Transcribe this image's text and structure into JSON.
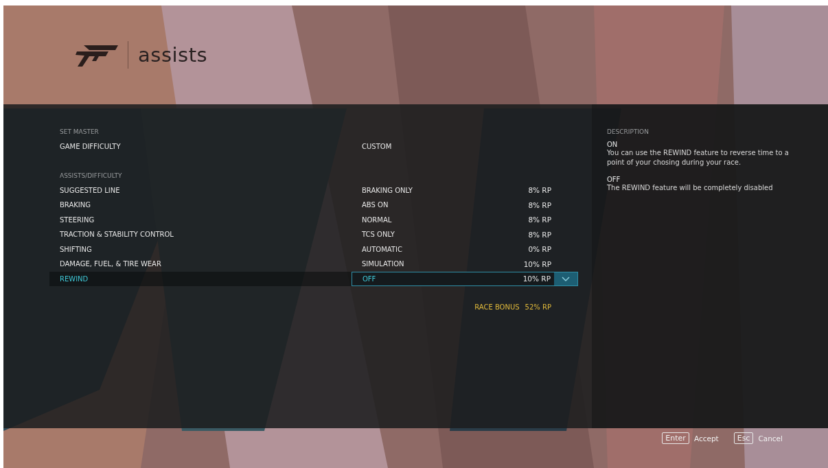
{
  "header": {
    "title": "assists"
  },
  "sections": [
    {
      "heading": "SET MASTER",
      "rows": [
        {
          "label": "GAME DIFFICULTY",
          "value": "CUSTOM",
          "selected": false
        }
      ]
    },
    {
      "heading": "ASSISTS/DIFFICULTY",
      "rows": [
        {
          "label": "SUGGESTED LINE",
          "value": "BRAKING ONLY",
          "bonus": "8% RP",
          "selected": false
        },
        {
          "label": "BRAKING",
          "value": "ABS ON",
          "bonus": "8% RP",
          "selected": false
        },
        {
          "label": "STEERING",
          "value": "NORMAL",
          "bonus": "8% RP",
          "selected": false
        },
        {
          "label": "TRACTION & STABILITY CONTROL",
          "value": "TCS ONLY",
          "bonus": "8% RP",
          "selected": false
        },
        {
          "label": "SHIFTING",
          "value": "AUTOMATIC",
          "bonus": "0% RP",
          "selected": false
        },
        {
          "label": "DAMAGE, FUEL, & TIRE WEAR",
          "value": "SIMULATION",
          "bonus": "10% RP",
          "selected": false
        },
        {
          "label": "REWIND",
          "value": "OFF",
          "bonus": "10% RP",
          "selected": true
        }
      ]
    }
  ],
  "race_bonus": {
    "label": "RACE BONUS",
    "value": "52% RP"
  },
  "description": {
    "heading": "DESCRIPTION",
    "entries": [
      {
        "title": "ON",
        "text": "You can use the REWIND feature to reverse time to a point of your chosing during your race."
      },
      {
        "title": "OFF",
        "text": "The REWIND feature will be completely disabled"
      }
    ]
  },
  "footer": {
    "actions": [
      {
        "key": "Enter",
        "label": "Accept"
      },
      {
        "key": "Esc",
        "label": "Cancel"
      }
    ]
  }
}
